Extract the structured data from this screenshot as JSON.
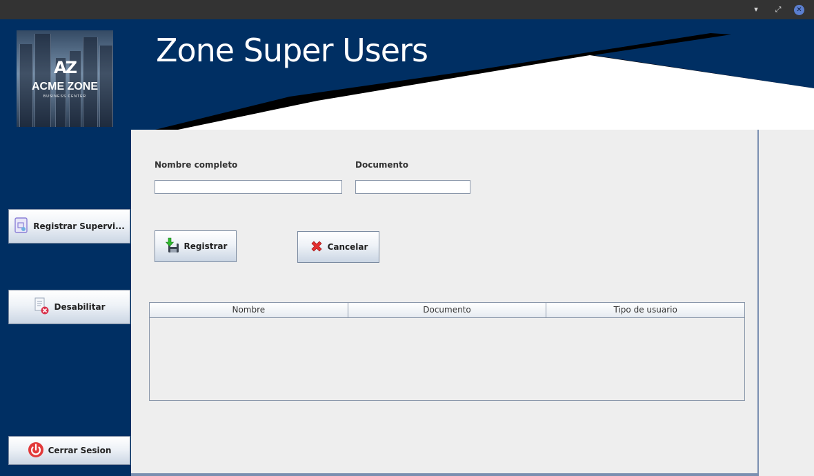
{
  "window": {
    "minimize_glyph": "▾",
    "restore_glyph": "⤢",
    "close_glyph": "✕"
  },
  "header": {
    "title": "Zone Super Users",
    "logo": {
      "mark": "AZ",
      "name": "ACME ZONE",
      "subtitle": "BUSINESS CENTER"
    }
  },
  "sidebar": {
    "items": [
      {
        "label": "Registrar Supervi...",
        "icon": "document-register-icon"
      },
      {
        "label": "Desabilitar",
        "icon": "document-disable-icon"
      },
      {
        "label": "Cerrar Sesion",
        "icon": "power-icon"
      }
    ]
  },
  "form": {
    "nombre_label": "Nombre completo",
    "nombre_value": "",
    "documento_label": "Documento",
    "documento_value": ""
  },
  "actions": {
    "registrar_label": "Registrar",
    "cancelar_label": "Cancelar"
  },
  "table": {
    "columns": [
      "Nombre",
      "Documento",
      "Tipo de usuario"
    ],
    "rows": []
  },
  "colors": {
    "header_bg": "#002f63",
    "panel_bg": "#eeeeee",
    "accent_border": "#7a8fb0"
  }
}
